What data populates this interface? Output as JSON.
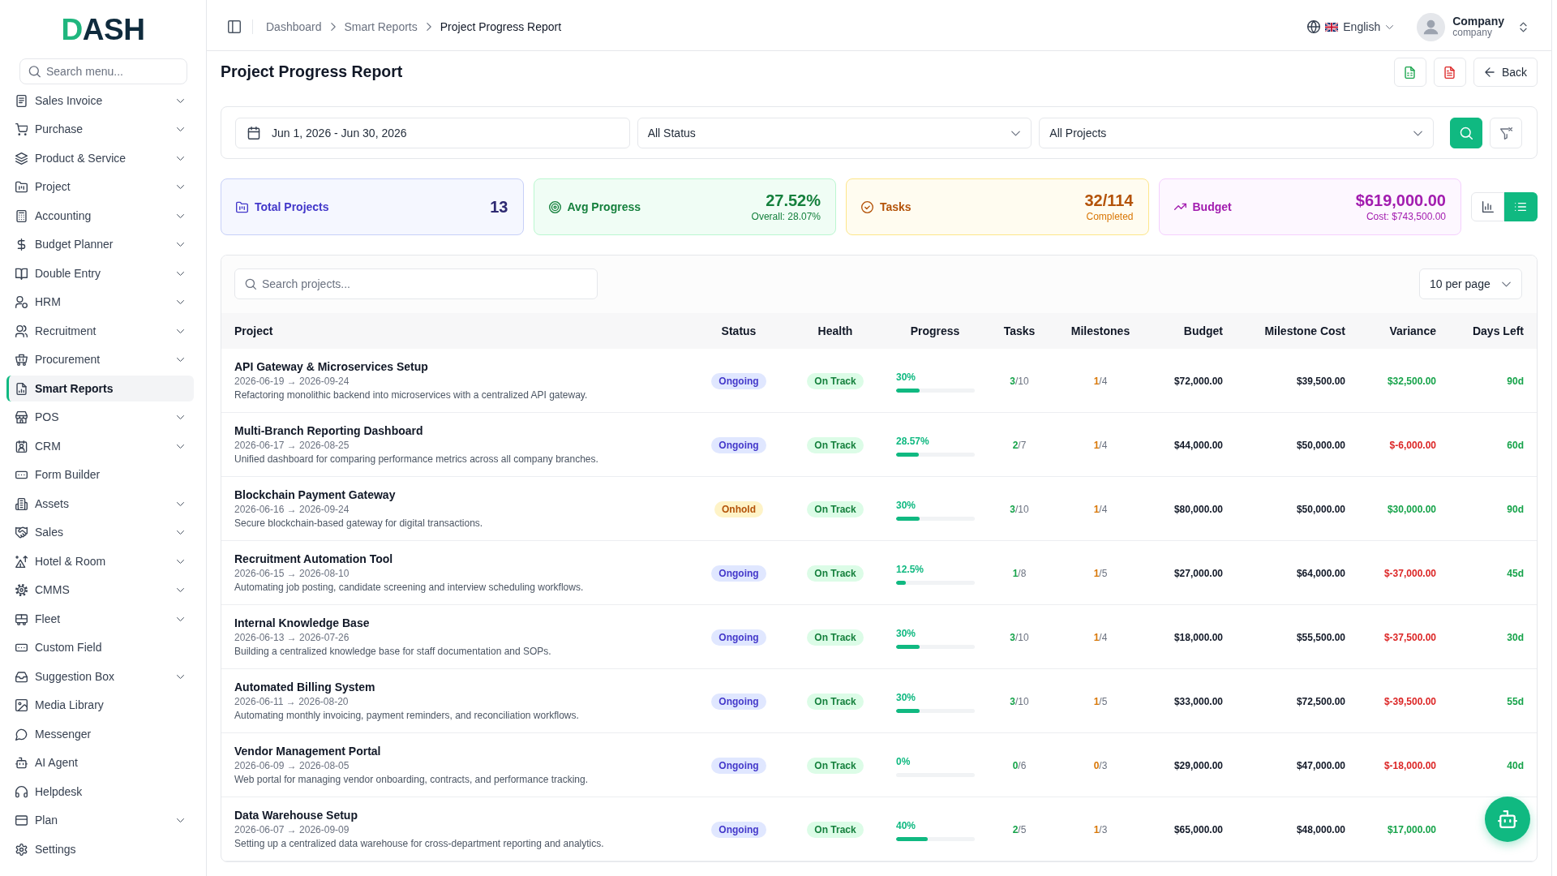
{
  "sidebar": {
    "logo": "DASH",
    "search": {
      "placeholder": "Search menu..."
    },
    "items": [
      {
        "label": "Sales Invoice",
        "kind": "group",
        "selected": false
      },
      {
        "label": "Purchase",
        "kind": "group",
        "selected": false
      },
      {
        "label": "Product & Service",
        "kind": "group",
        "selected": false
      },
      {
        "label": "Project",
        "kind": "group",
        "selected": false
      },
      {
        "label": "Accounting",
        "kind": "group",
        "selected": false
      },
      {
        "label": "Budget Planner",
        "kind": "group",
        "selected": false
      },
      {
        "label": "Double Entry",
        "kind": "group",
        "selected": false
      },
      {
        "label": "HRM",
        "kind": "group",
        "selected": false
      },
      {
        "label": "Recruitment",
        "kind": "group",
        "selected": false
      },
      {
        "label": "Procurement",
        "kind": "group",
        "selected": false
      },
      {
        "label": "Smart Reports",
        "kind": "link",
        "selected": true
      },
      {
        "label": "POS",
        "kind": "group",
        "selected": false
      },
      {
        "label": "CRM",
        "kind": "group",
        "selected": false
      },
      {
        "label": "Form Builder",
        "kind": "link",
        "selected": false
      },
      {
        "label": "Assets",
        "kind": "group",
        "selected": false
      },
      {
        "label": "Sales",
        "kind": "group",
        "selected": false
      },
      {
        "label": "Hotel & Room",
        "kind": "group",
        "selected": false
      },
      {
        "label": "CMMS",
        "kind": "group",
        "selected": false
      },
      {
        "label": "Fleet",
        "kind": "group",
        "selected": false
      },
      {
        "label": "Custom Field",
        "kind": "link",
        "selected": false
      },
      {
        "label": "Suggestion Box",
        "kind": "group",
        "selected": false
      },
      {
        "label": "Media Library",
        "kind": "link",
        "selected": false
      },
      {
        "label": "Messenger",
        "kind": "link",
        "selected": false
      },
      {
        "label": "AI Agent",
        "kind": "link",
        "selected": false
      },
      {
        "label": "Helpdesk",
        "kind": "link",
        "selected": false
      },
      {
        "label": "Plan",
        "kind": "group",
        "selected": false
      },
      {
        "label": "Settings",
        "kind": "link",
        "selected": false
      }
    ]
  },
  "header": {
    "breadcrumb": [
      {
        "label": "Dashboard",
        "current": false
      },
      {
        "label": "Smart Reports",
        "current": false
      },
      {
        "label": "Project Progress Report",
        "current": true
      }
    ],
    "language": "English",
    "user": {
      "name": "Company",
      "role": "company"
    }
  },
  "page": {
    "title": "Project Progress Report",
    "back_button": "Back"
  },
  "filters": {
    "date_range": "Jun 1, 2026 - Jun 30, 2026",
    "status": "All Status",
    "project": "All Projects"
  },
  "stats": [
    {
      "kind": "projects",
      "label": "Total Projects",
      "value": "13"
    },
    {
      "kind": "progress",
      "label": "Avg Progress",
      "value": "27.52%",
      "note": "Overall: 28.07%"
    },
    {
      "kind": "tasks",
      "label": "Tasks",
      "value": "32/114",
      "note": "Completed"
    },
    {
      "kind": "budget",
      "label": "Budget",
      "value": "$619,000.00",
      "note": "Cost: $743,500.00"
    }
  ],
  "view_modes": [
    {
      "selected": false
    },
    {
      "selected": true
    }
  ],
  "table": {
    "search": {
      "placeholder": "Search projects..."
    },
    "per_page": "10 per page",
    "columns": [
      "Project",
      "Status",
      "Health",
      "Progress",
      "Tasks",
      "Milestones",
      "Budget",
      "Milestone Cost",
      "Variance",
      "Days Left"
    ],
    "rows": [
      {
        "name": "API Gateway & Microservices Setup",
        "dates": "2026-06-19 → 2026-09-24",
        "description": "Refactoring monolithic backend into microservices with a centralized API gateway.",
        "status": {
          "label": "Ongoing",
          "kind": "ongoing"
        },
        "health": {
          "label": "On Track",
          "kind": "on_track"
        },
        "progress": {
          "label": "30%",
          "level": 0.3
        },
        "tasks": "**3**/10",
        "milestones": "**1**/4",
        "budget": "$72,000.00",
        "milestone_cost": "$39,500.00",
        "variance": {
          "value": "$32,500.00",
          "negative": false
        },
        "days_left": "90d"
      },
      {
        "name": "Multi-Branch Reporting Dashboard",
        "dates": "2026-06-17 → 2026-08-25",
        "description": "Unified dashboard for comparing performance metrics across all company branches.",
        "status": {
          "label": "Ongoing",
          "kind": "ongoing"
        },
        "health": {
          "label": "On Track",
          "kind": "on_track"
        },
        "progress": {
          "label": "28.57%",
          "level": 0.2857
        },
        "tasks": "**2**/7",
        "milestones": "**1**/4",
        "budget": "$44,000.00",
        "milestone_cost": "$50,000.00",
        "variance": {
          "value": "$-6,000.00",
          "negative": true
        },
        "days_left": "60d"
      },
      {
        "name": "Blockchain Payment Gateway",
        "dates": "2026-06-16 → 2026-09-24",
        "description": "Secure blockchain-based gateway for digital transactions.",
        "status": {
          "label": "Onhold",
          "kind": "onhold"
        },
        "health": {
          "label": "On Track",
          "kind": "on_track"
        },
        "progress": {
          "label": "30%",
          "level": 0.3
        },
        "tasks": "**3**/10",
        "milestones": "**1**/4",
        "budget": "$80,000.00",
        "milestone_cost": "$50,000.00",
        "variance": {
          "value": "$30,000.00",
          "negative": false
        },
        "days_left": "90d"
      },
      {
        "name": "Recruitment Automation Tool",
        "dates": "2026-06-15 → 2026-08-10",
        "description": "Automating job posting, candidate screening and interview scheduling workflows.",
        "status": {
          "label": "Ongoing",
          "kind": "ongoing"
        },
        "health": {
          "label": "On Track",
          "kind": "on_track"
        },
        "progress": {
          "label": "12.5%",
          "level": 0.125
        },
        "tasks": "**1**/8",
        "milestones": "**1**/5",
        "budget": "$27,000.00",
        "milestone_cost": "$64,000.00",
        "variance": {
          "value": "$-37,000.00",
          "negative": true
        },
        "days_left": "45d"
      },
      {
        "name": "Internal Knowledge Base",
        "dates": "2026-06-13 → 2026-07-26",
        "description": "Building a centralized knowledge base for staff documentation and SOPs.",
        "status": {
          "label": "Ongoing",
          "kind": "ongoing"
        },
        "health": {
          "label": "On Track",
          "kind": "on_track"
        },
        "progress": {
          "label": "30%",
          "level": 0.3
        },
        "tasks": "**3**/10",
        "milestones": "**1**/4",
        "budget": "$18,000.00",
        "milestone_cost": "$55,500.00",
        "variance": {
          "value": "$-37,500.00",
          "negative": true
        },
        "days_left": "30d"
      },
      {
        "name": "Automated Billing System",
        "dates": "2026-06-11 → 2026-08-20",
        "description": "Automating monthly invoicing, payment reminders, and reconciliation workflows.",
        "status": {
          "label": "Ongoing",
          "kind": "ongoing"
        },
        "health": {
          "label": "On Track",
          "kind": "on_track"
        },
        "progress": {
          "label": "30%",
          "level": 0.3
        },
        "tasks": "**3**/10",
        "milestones": "**1**/5",
        "budget": "$33,000.00",
        "milestone_cost": "$72,500.00",
        "variance": {
          "value": "$-39,500.00",
          "negative": true
        },
        "days_left": "55d"
      },
      {
        "name": "Vendor Management Portal",
        "dates": "2026-06-09 → 2026-08-05",
        "description": "Web portal for managing vendor onboarding, contracts, and performance tracking.",
        "status": {
          "label": "Ongoing",
          "kind": "ongoing"
        },
        "health": {
          "label": "On Track",
          "kind": "on_track"
        },
        "progress": {
          "label": "0%"
        },
        "tasks": "**0**/6",
        "milestones": "**0**/3",
        "budget": "$29,000.00",
        "milestone_cost": "$47,000.00",
        "variance": {
          "value": "$-18,000.00",
          "negative": true
        },
        "days_left": "40d"
      },
      {
        "name": "Data Warehouse Setup",
        "dates": "2026-06-07 → 2026-09-09",
        "description": "Setting up a centralized data warehouse for cross-department reporting and analytics.",
        "status": {
          "label": "Ongoing",
          "kind": "ongoing"
        },
        "health": {
          "label": "On Track",
          "kind": "on_track"
        },
        "progress": {
          "label": "40%",
          "level": 0.4
        },
        "tasks": "**2**/5",
        "milestones": "**1**/3",
        "budget": "$65,000.00",
        "milestone_cost": "$48,000.00",
        "variance": {
          "value": "$17,000.00",
          "negative": false
        }
      }
    ]
  }
}
